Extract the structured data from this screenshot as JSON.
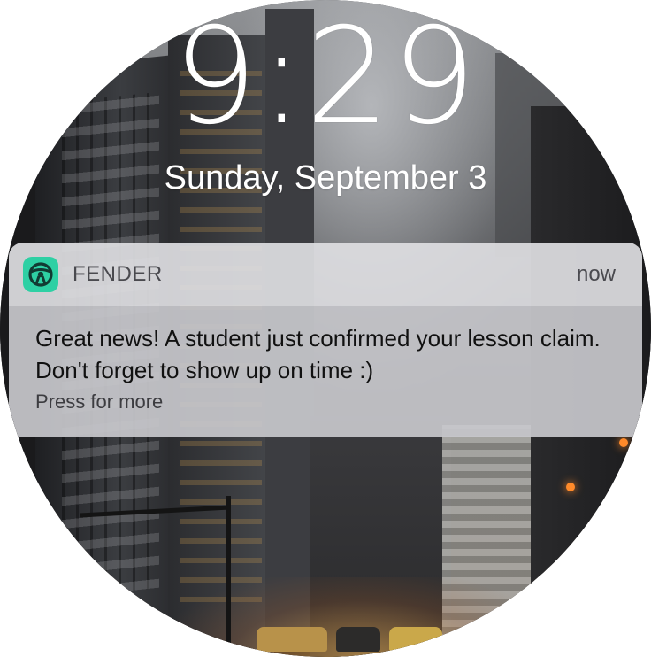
{
  "lockscreen": {
    "time": "9:29",
    "date": "Sunday, September 3"
  },
  "notification": {
    "app_name": "FENDER",
    "app_icon": "steering-wheel-icon",
    "app_icon_color": "#2ed0a4",
    "timestamp": "now",
    "message": "Great news! A student just confirmed your lesson claim. Don't forget to show up on time :)",
    "hint": "Press for more"
  }
}
